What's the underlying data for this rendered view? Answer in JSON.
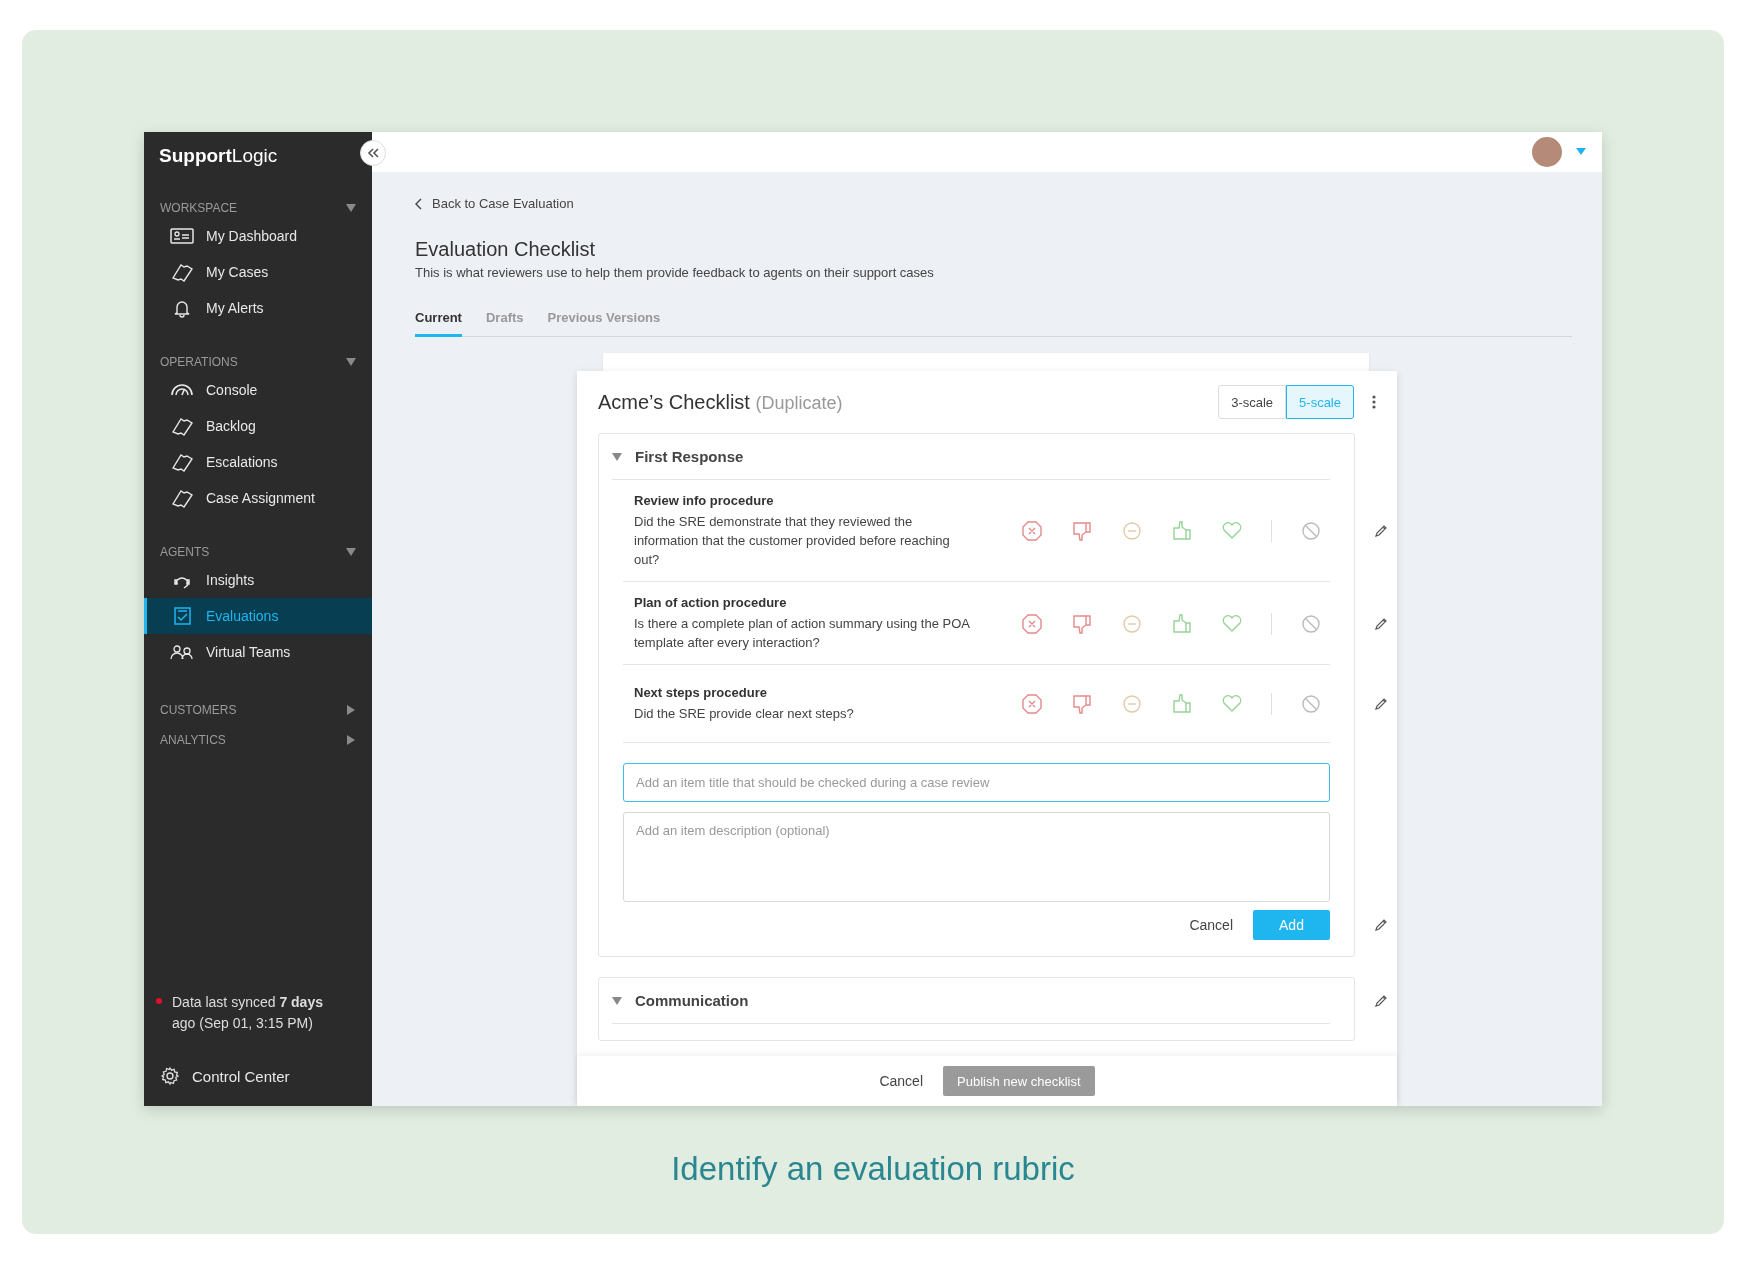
{
  "brand": {
    "strong": "Support",
    "light": "Logic"
  },
  "sidebar": {
    "sections": [
      {
        "label": "WORKSPACE",
        "expanded": true,
        "items": [
          {
            "label": "My Dashboard",
            "selected": false
          },
          {
            "label": "My Cases",
            "selected": false
          },
          {
            "label": "My Alerts",
            "selected": false
          }
        ]
      },
      {
        "label": "OPERATIONS",
        "expanded": true,
        "items": [
          {
            "label": "Console",
            "selected": false
          },
          {
            "label": "Backlog",
            "selected": false
          },
          {
            "label": "Escalations",
            "selected": false
          },
          {
            "label": "Case Assignment",
            "selected": false
          }
        ]
      },
      {
        "label": "AGENTS",
        "expanded": true,
        "items": [
          {
            "label": "Insights",
            "selected": false
          },
          {
            "label": "Evaluations",
            "selected": true
          },
          {
            "label": "Virtual Teams",
            "selected": false
          }
        ]
      },
      {
        "label": "CUSTOMERS",
        "expanded": false
      },
      {
        "label": "ANALYTICS",
        "expanded": false
      }
    ],
    "sync_status": "Data last synced **7 days** ago (Sep 01, 3:15 PM)",
    "footer_link": "Control Center"
  },
  "back_link": "Back to Case Evaluation",
  "page": {
    "title": "Evaluation Checklist",
    "subtitle": "This is what reviewers use to help them provide feedback to agents on their support cases"
  },
  "tabs": [
    {
      "label": "Current",
      "selected": true
    },
    {
      "label": "Drafts",
      "selected": false
    },
    {
      "label": "Previous Versions",
      "selected": false
    }
  ],
  "checklist": {
    "title": "Acme’s Checklist",
    "suffix": "(Duplicate)",
    "scales": [
      {
        "label": "3-scale",
        "selected": false
      },
      {
        "label": "5-scale",
        "selected": true
      }
    ],
    "sections": [
      {
        "title": "First Response",
        "expanded": true,
        "items": [
          {
            "title": "Review info procedure",
            "description": "Did the SRE demonstrate that they reviewed the information that the customer provided before reaching out?"
          },
          {
            "title": "Plan of action procedure",
            "description": "Is there a complete plan of action summary using the POA template after every interaction?"
          },
          {
            "title": "Next steps procedure",
            "description": "Did the SRE provide clear next steps?"
          }
        ],
        "new_item": {
          "title_placeholder": "Add an item title that should be checked during a case review",
          "description_placeholder": "Add an item description (optional)",
          "cancel": "Cancel",
          "add": "Add"
        }
      },
      {
        "title": "Communication",
        "expanded": true
      }
    ],
    "footer": {
      "cancel": "Cancel",
      "publish": "Publish new checklist",
      "publish_disabled": true
    }
  },
  "caption": "Identify an evaluation rubric"
}
